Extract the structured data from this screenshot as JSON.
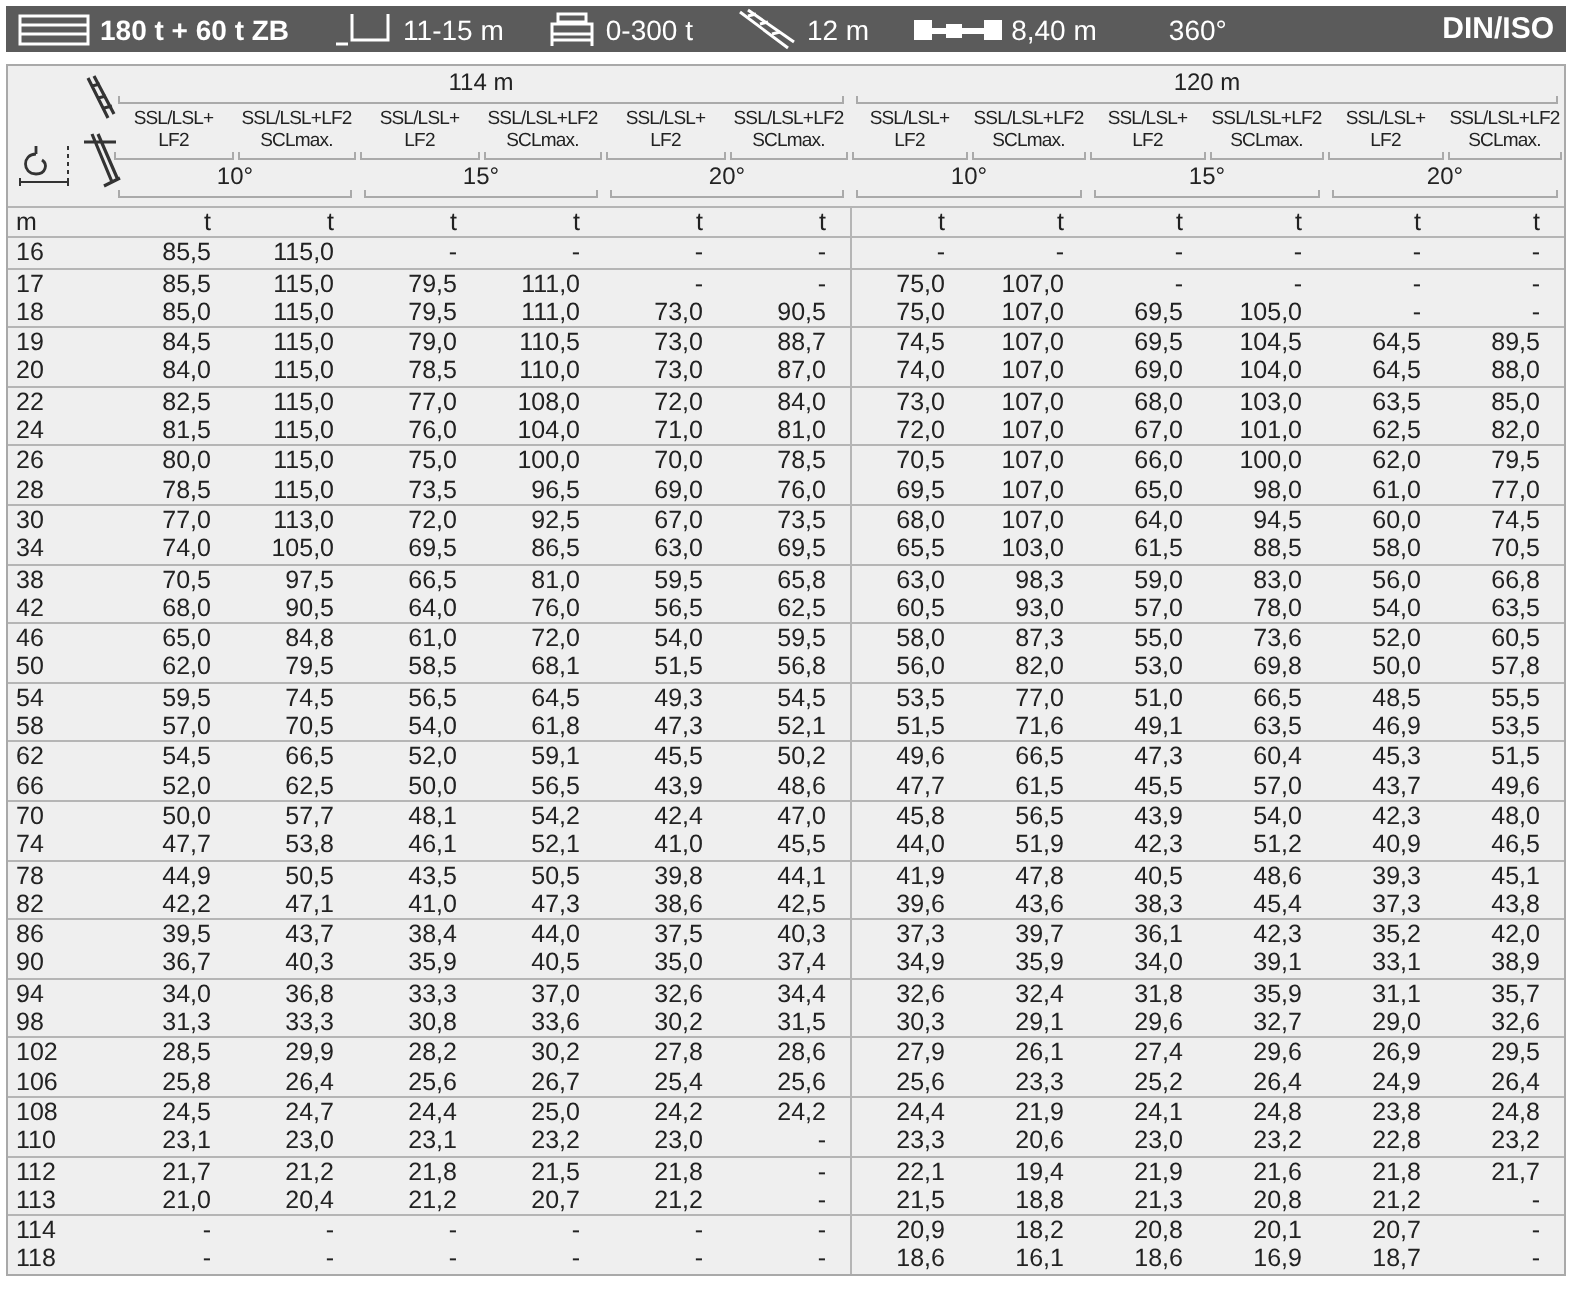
{
  "spec_bar": {
    "items": [
      {
        "kind": "counterweight",
        "text": "180 t + 60 t ZB"
      },
      {
        "kind": "outrigger",
        "text": "11-15 m"
      },
      {
        "kind": "ballast",
        "text": "0-300 t"
      },
      {
        "kind": "jib",
        "text": "12 m"
      },
      {
        "kind": "width",
        "text": "8,40 m"
      },
      {
        "kind": "slew",
        "text": "360°"
      }
    ],
    "standard": "DIN/ISO"
  },
  "table": {
    "booms": [
      {
        "label": "114 m",
        "angles": [
          {
            "label": "10°",
            "configs": [
              "SSL/LSL+\nLF2",
              "SSL/LSL+LF2\nSCLmax."
            ]
          },
          {
            "label": "15°",
            "configs": [
              "SSL/LSL+\nLF2",
              "SSL/LSL+LF2\nSCLmax."
            ]
          },
          {
            "label": "20°",
            "configs": [
              "SSL/LSL+\nLF2",
              "SSL/LSL+LF2\nSCLmax."
            ]
          }
        ]
      },
      {
        "label": "120 m",
        "angles": [
          {
            "label": "10°",
            "configs": [
              "SSL/LSL+\nLF2",
              "SSL/LSL+LF2\nSCLmax."
            ]
          },
          {
            "label": "15°",
            "configs": [
              "SSL/LSL+\nLF2",
              "SSL/LSL+LF2\nSCLmax."
            ]
          },
          {
            "label": "20°",
            "configs": [
              "SSL/LSL+\nLF2",
              "SSL/LSL+LF2\nSCLmax."
            ]
          }
        ]
      }
    ],
    "units": [
      "m",
      "t",
      "t",
      "t",
      "t",
      "t",
      "t",
      "t",
      "t",
      "t",
      "t",
      "t",
      "t"
    ],
    "row_groups": [
      [
        {
          "m": "16",
          "values": [
            "85,5",
            "115,0",
            "-",
            "-",
            "-",
            "-",
            "-",
            "-",
            "-",
            "-",
            "-",
            "-"
          ]
        }
      ],
      [
        {
          "m": "17",
          "values": [
            "85,5",
            "115,0",
            "79,5",
            "111,0",
            "-",
            "-",
            "75,0",
            "107,0",
            "-",
            "-",
            "-",
            "-"
          ]
        },
        {
          "m": "18",
          "values": [
            "85,0",
            "115,0",
            "79,5",
            "111,0",
            "73,0",
            "90,5",
            "75,0",
            "107,0",
            "69,5",
            "105,0",
            "-",
            "-"
          ]
        }
      ],
      [
        {
          "m": "19",
          "values": [
            "84,5",
            "115,0",
            "79,0",
            "110,5",
            "73,0",
            "88,7",
            "74,5",
            "107,0",
            "69,5",
            "104,5",
            "64,5",
            "89,5"
          ]
        },
        {
          "m": "20",
          "values": [
            "84,0",
            "115,0",
            "78,5",
            "110,0",
            "73,0",
            "87,0",
            "74,0",
            "107,0",
            "69,0",
            "104,0",
            "64,5",
            "88,0"
          ]
        }
      ],
      [
        {
          "m": "22",
          "values": [
            "82,5",
            "115,0",
            "77,0",
            "108,0",
            "72,0",
            "84,0",
            "73,0",
            "107,0",
            "68,0",
            "103,0",
            "63,5",
            "85,0"
          ]
        },
        {
          "m": "24",
          "values": [
            "81,5",
            "115,0",
            "76,0",
            "104,0",
            "71,0",
            "81,0",
            "72,0",
            "107,0",
            "67,0",
            "101,0",
            "62,5",
            "82,0"
          ]
        }
      ],
      [
        {
          "m": "26",
          "values": [
            "80,0",
            "115,0",
            "75,0",
            "100,0",
            "70,0",
            "78,5",
            "70,5",
            "107,0",
            "66,0",
            "100,0",
            "62,0",
            "79,5"
          ]
        },
        {
          "m": "28",
          "values": [
            "78,5",
            "115,0",
            "73,5",
            "96,5",
            "69,0",
            "76,0",
            "69,5",
            "107,0",
            "65,0",
            "98,0",
            "61,0",
            "77,0"
          ]
        }
      ],
      [
        {
          "m": "30",
          "values": [
            "77,0",
            "113,0",
            "72,0",
            "92,5",
            "67,0",
            "73,5",
            "68,0",
            "107,0",
            "64,0",
            "94,5",
            "60,0",
            "74,5"
          ]
        },
        {
          "m": "34",
          "values": [
            "74,0",
            "105,0",
            "69,5",
            "86,5",
            "63,0",
            "69,5",
            "65,5",
            "103,0",
            "61,5",
            "88,5",
            "58,0",
            "70,5"
          ]
        }
      ],
      [
        {
          "m": "38",
          "values": [
            "70,5",
            "97,5",
            "66,5",
            "81,0",
            "59,5",
            "65,8",
            "63,0",
            "98,3",
            "59,0",
            "83,0",
            "56,0",
            "66,8"
          ]
        },
        {
          "m": "42",
          "values": [
            "68,0",
            "90,5",
            "64,0",
            "76,0",
            "56,5",
            "62,5",
            "60,5",
            "93,0",
            "57,0",
            "78,0",
            "54,0",
            "63,5"
          ]
        }
      ],
      [
        {
          "m": "46",
          "values": [
            "65,0",
            "84,8",
            "61,0",
            "72,0",
            "54,0",
            "59,5",
            "58,0",
            "87,3",
            "55,0",
            "73,6",
            "52,0",
            "60,5"
          ]
        },
        {
          "m": "50",
          "values": [
            "62,0",
            "79,5",
            "58,5",
            "68,1",
            "51,5",
            "56,8",
            "56,0",
            "82,0",
            "53,0",
            "69,8",
            "50,0",
            "57,8"
          ]
        }
      ],
      [
        {
          "m": "54",
          "values": [
            "59,5",
            "74,5",
            "56,5",
            "64,5",
            "49,3",
            "54,5",
            "53,5",
            "77,0",
            "51,0",
            "66,5",
            "48,5",
            "55,5"
          ]
        },
        {
          "m": "58",
          "values": [
            "57,0",
            "70,5",
            "54,0",
            "61,8",
            "47,3",
            "52,1",
            "51,5",
            "71,6",
            "49,1",
            "63,5",
            "46,9",
            "53,5"
          ]
        }
      ],
      [
        {
          "m": "62",
          "values": [
            "54,5",
            "66,5",
            "52,0",
            "59,1",
            "45,5",
            "50,2",
            "49,6",
            "66,5",
            "47,3",
            "60,4",
            "45,3",
            "51,5"
          ]
        },
        {
          "m": "66",
          "values": [
            "52,0",
            "62,5",
            "50,0",
            "56,5",
            "43,9",
            "48,6",
            "47,7",
            "61,5",
            "45,5",
            "57,0",
            "43,7",
            "49,6"
          ]
        }
      ],
      [
        {
          "m": "70",
          "values": [
            "50,0",
            "57,7",
            "48,1",
            "54,2",
            "42,4",
            "47,0",
            "45,8",
            "56,5",
            "43,9",
            "54,0",
            "42,3",
            "48,0"
          ]
        },
        {
          "m": "74",
          "values": [
            "47,7",
            "53,8",
            "46,1",
            "52,1",
            "41,0",
            "45,5",
            "44,0",
            "51,9",
            "42,3",
            "51,2",
            "40,9",
            "46,5"
          ]
        }
      ],
      [
        {
          "m": "78",
          "values": [
            "44,9",
            "50,5",
            "43,5",
            "50,5",
            "39,8",
            "44,1",
            "41,9",
            "47,8",
            "40,5",
            "48,6",
            "39,3",
            "45,1"
          ]
        },
        {
          "m": "82",
          "values": [
            "42,2",
            "47,1",
            "41,0",
            "47,3",
            "38,6",
            "42,5",
            "39,6",
            "43,6",
            "38,3",
            "45,4",
            "37,3",
            "43,8"
          ]
        }
      ],
      [
        {
          "m": "86",
          "values": [
            "39,5",
            "43,7",
            "38,4",
            "44,0",
            "37,5",
            "40,3",
            "37,3",
            "39,7",
            "36,1",
            "42,3",
            "35,2",
            "42,0"
          ]
        },
        {
          "m": "90",
          "values": [
            "36,7",
            "40,3",
            "35,9",
            "40,5",
            "35,0",
            "37,4",
            "34,9",
            "35,9",
            "34,0",
            "39,1",
            "33,1",
            "38,9"
          ]
        }
      ],
      [
        {
          "m": "94",
          "values": [
            "34,0",
            "36,8",
            "33,3",
            "37,0",
            "32,6",
            "34,4",
            "32,6",
            "32,4",
            "31,8",
            "35,9",
            "31,1",
            "35,7"
          ]
        },
        {
          "m": "98",
          "values": [
            "31,3",
            "33,3",
            "30,8",
            "33,6",
            "30,2",
            "31,5",
            "30,3",
            "29,1",
            "29,6",
            "32,7",
            "29,0",
            "32,6"
          ]
        }
      ],
      [
        {
          "m": "102",
          "values": [
            "28,5",
            "29,9",
            "28,2",
            "30,2",
            "27,8",
            "28,6",
            "27,9",
            "26,1",
            "27,4",
            "29,6",
            "26,9",
            "29,5"
          ]
        },
        {
          "m": "106",
          "values": [
            "25,8",
            "26,4",
            "25,6",
            "26,7",
            "25,4",
            "25,6",
            "25,6",
            "23,3",
            "25,2",
            "26,4",
            "24,9",
            "26,4"
          ]
        }
      ],
      [
        {
          "m": "108",
          "values": [
            "24,5",
            "24,7",
            "24,4",
            "25,0",
            "24,2",
            "24,2",
            "24,4",
            "21,9",
            "24,1",
            "24,8",
            "23,8",
            "24,8"
          ]
        },
        {
          "m": "110",
          "values": [
            "23,1",
            "23,0",
            "23,1",
            "23,2",
            "23,0",
            "-",
            "23,3",
            "20,6",
            "23,0",
            "23,2",
            "22,8",
            "23,2"
          ]
        }
      ],
      [
        {
          "m": "112",
          "values": [
            "21,7",
            "21,2",
            "21,8",
            "21,5",
            "21,8",
            "-",
            "22,1",
            "19,4",
            "21,9",
            "21,6",
            "21,8",
            "21,7"
          ]
        },
        {
          "m": "113",
          "values": [
            "21,0",
            "20,4",
            "21,2",
            "20,7",
            "21,2",
            "-",
            "21,5",
            "18,8",
            "21,3",
            "20,8",
            "21,2",
            "-"
          ]
        }
      ],
      [
        {
          "m": "114",
          "values": [
            "-",
            "-",
            "-",
            "-",
            "-",
            "-",
            "20,9",
            "18,2",
            "20,8",
            "20,1",
            "20,7",
            "-"
          ]
        },
        {
          "m": "118",
          "values": [
            "-",
            "-",
            "-",
            "-",
            "-",
            "-",
            "18,6",
            "16,1",
            "18,6",
            "16,9",
            "18,7",
            "-"
          ]
        }
      ]
    ]
  }
}
